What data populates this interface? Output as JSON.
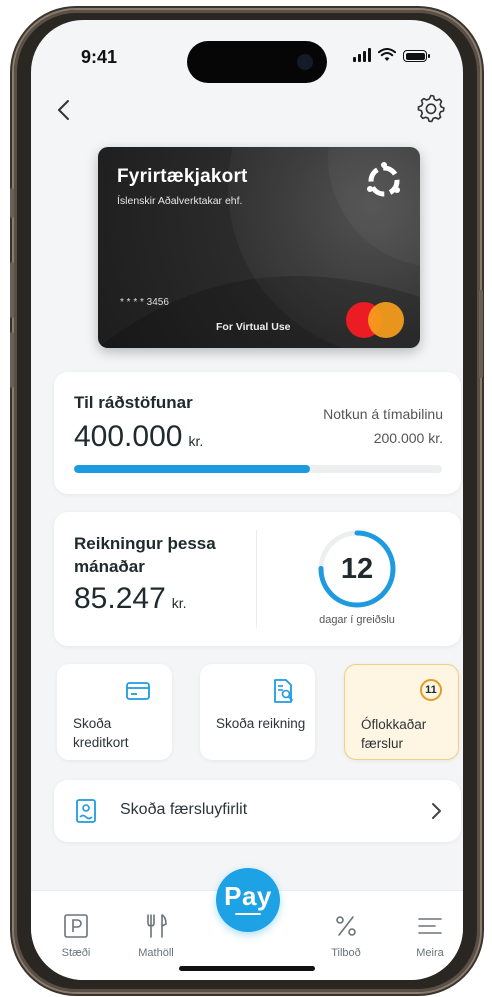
{
  "status_bar": {
    "time": "9:41"
  },
  "card": {
    "title": "Fyrirtækjakort",
    "company": "Íslenskir Aðalverktakar ehf.",
    "number_masked": "* * * * 3456",
    "virtual_label": "For Virtual Use",
    "brand_icon": "brand-logo-icon",
    "network_icon": "mastercard-icon"
  },
  "available": {
    "title": "Til ráðstöfunar",
    "amount": "400.000",
    "unit": "kr.",
    "usage_label": "Notkun á tímabilinu",
    "usage_value": "200.000 kr.",
    "progress_fraction": 0.64
  },
  "bill": {
    "title": "Reikningur þessa mánaðar",
    "amount": "85.247",
    "unit": "kr.",
    "days": "12",
    "days_label": "dagar í greiðslu"
  },
  "tiles": [
    {
      "label": "Skoða kreditkort",
      "icon": "credit-card-icon"
    },
    {
      "label": "Skoða reikning",
      "icon": "invoice-search-icon"
    },
    {
      "label": "Óflokkaðar færslur",
      "count": "11"
    }
  ],
  "statement": {
    "label": "Skoða færsluyfirlit",
    "icon": "receipt-icon"
  },
  "tabbar": {
    "items": [
      {
        "label": "Stæði",
        "icon": "parking-icon"
      },
      {
        "label": "Mathöll",
        "icon": "fork-knife-icon"
      },
      {
        "label": "Tilboð",
        "icon": "percent-icon"
      },
      {
        "label": "Meira",
        "icon": "menu-icon"
      }
    ],
    "pay_label": "Pay"
  },
  "colors": {
    "accent": "#1ea2e6",
    "warning_border": "#f4cd84",
    "warning_bg": "#fff5e3",
    "badge_ring": "#e29c24",
    "background": "#f3f5f6"
  }
}
